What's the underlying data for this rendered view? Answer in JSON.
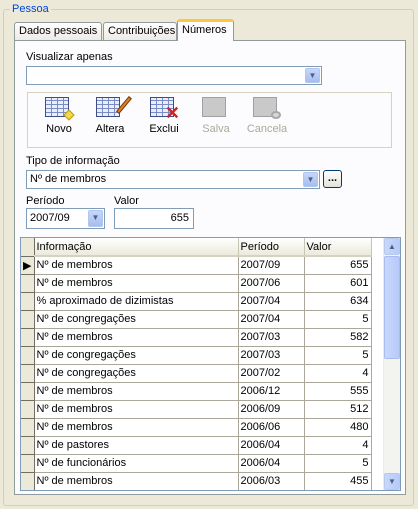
{
  "group_title": "Pessoa",
  "tabs": [
    {
      "label": "Dados pessoais",
      "active": false
    },
    {
      "label": "Contribuições",
      "active": false
    },
    {
      "label": "Números",
      "active": true
    }
  ],
  "filter": {
    "label": "Visualizar apenas",
    "value": ""
  },
  "toolbar": {
    "novo": {
      "label": "Novo",
      "icon": "new-grid-icon",
      "enabled": true
    },
    "altera": {
      "label": "Altera",
      "icon": "edit-grid-icon",
      "enabled": true
    },
    "exclui": {
      "label": "Exclui",
      "icon": "delete-grid-icon",
      "enabled": true
    },
    "salva": {
      "label": "Salva",
      "icon": "save-grid-icon",
      "enabled": false
    },
    "cancela": {
      "label": "Cancela",
      "icon": "cancel-grid-icon",
      "enabled": false
    }
  },
  "tipo": {
    "label": "Tipo de informação",
    "value": "Nº de membros",
    "button_label": "..."
  },
  "periodo": {
    "label": "Período",
    "value": "2007/09"
  },
  "valor": {
    "label": "Valor",
    "value": "655"
  },
  "grid": {
    "columns": [
      "Informação",
      "Período",
      "Valor"
    ],
    "rows": [
      [
        "Nº de membros",
        "2007/09",
        "655"
      ],
      [
        "Nº de membros",
        "2007/06",
        "601"
      ],
      [
        "% aproximado de dizimistas",
        "2007/04",
        "634"
      ],
      [
        "Nº de congregações",
        "2007/04",
        "5"
      ],
      [
        "Nº de membros",
        "2007/03",
        "582"
      ],
      [
        "Nº de congregações",
        "2007/03",
        "5"
      ],
      [
        "Nº de congregações",
        "2007/02",
        "4"
      ],
      [
        "Nº de membros",
        "2006/12",
        "555"
      ],
      [
        "Nº de membros",
        "2006/09",
        "512"
      ],
      [
        "Nº de membros",
        "2006/06",
        "480"
      ],
      [
        "Nº de pastores",
        "2006/04",
        "4"
      ],
      [
        "Nº de funcionários",
        "2006/04",
        "5"
      ],
      [
        "Nº de membros",
        "2006/03",
        "455"
      ]
    ],
    "current_row_marker": "▶"
  },
  "colors": {
    "tab_highlight": "#ffc83c",
    "group_title": "#0046d5",
    "delete_x": "#d42020"
  }
}
